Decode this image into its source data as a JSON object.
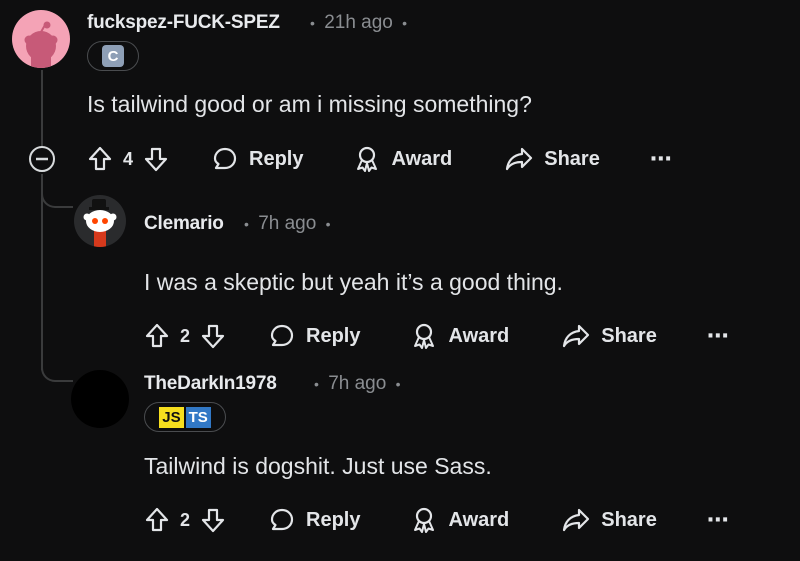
{
  "comments": [
    {
      "username": "fuckspez-FUCK-SPEZ",
      "time": "21h ago",
      "body": "Is tailwind good or am i missing something?",
      "votes": "4",
      "flair": "C"
    },
    {
      "username": "Clemario",
      "time": "7h ago",
      "body": "I was a skeptic but yeah it’s a good thing.",
      "votes": "2"
    },
    {
      "username": "TheDarkIn1978",
      "time": "7h ago",
      "body": "Tailwind is dogshit. Just use Sass.",
      "votes": "2",
      "flair": [
        "JS",
        "TS"
      ]
    }
  ],
  "actions": {
    "reply": "Reply",
    "award": "Award",
    "share": "Share",
    "more": "⋯",
    "dot": "•"
  },
  "colors": {
    "background": "#0e0e0f",
    "thread_line": "#3a3b3c",
    "js": "#f7df1e",
    "ts": "#3178c6"
  }
}
